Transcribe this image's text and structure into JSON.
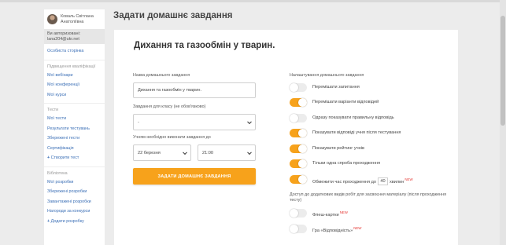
{
  "page_title": "Задати домашнє завдання",
  "sidebar": {
    "user_name": "Коваль Світлана Анатоліївна",
    "auth_line1": "Ви авторизовані:",
    "auth_line2": "lana204@ukr.net",
    "personal_page": "Особиста сторінка",
    "section_qualification": "Підвищення кваліфікації",
    "my_webinars": "Мої вебінари",
    "my_conferences": "Мої конференції",
    "my_courses": "Мої курси",
    "section_tests": "Тести",
    "my_tests": "Мої тести",
    "test_results": "Результати тестувань",
    "saved_tests": "Збережені тести",
    "certification": "Сертифікація",
    "create_test": "Створити тест",
    "section_library": "Бібліотека",
    "my_materials": "Мої розробки",
    "saved_materials": "Збережені розробки",
    "downloaded_materials": "Завантажені розробки",
    "contest_awards": "Нагороди за конкурси",
    "add_material": "Додати розробку"
  },
  "form": {
    "card_title": "Дихання та газообмін у тварин.",
    "name_label": "Назва домашнього завдання",
    "name_value": "Дихання та газообмін  у тварин.",
    "class_label": "Завдання для класу (не обов'язково)",
    "class_value": "-",
    "deadline_label": "Учням необхідно виконати завдання до",
    "date_value": "22 березня",
    "time_value": "21:00",
    "submit_label": "ЗАДАТИ ДОМАШНЄ ЗАВДАННЯ"
  },
  "settings": {
    "title": "Налаштування домашнього завдання",
    "shuffle_questions": "Перемішати запитання",
    "shuffle_answers": "Перемішати варіанти відповідей",
    "show_correct_now": "Одразу показувати правильну відповідь",
    "show_answers_after": "Показувати відповіді учня після тестування",
    "show_rating": "Показувати рейтинг учнів",
    "one_attempt": "Тільки одна спроба проходження",
    "limit_time_prefix": "Обмежити час проходження до",
    "limit_time_value": "40",
    "limit_time_suffix": "хвилин",
    "new_badge": "NEW",
    "extra_note": "Доступ до додаткових видів робіт для засвоєння матеріалу (після проходження тесту)",
    "flashcards": "Флеш-картки",
    "game": "Гра «Відповідність»"
  },
  "toggle_states": {
    "shuffle_questions": false,
    "shuffle_answers": true,
    "show_correct_now": false,
    "show_answers_after": true,
    "show_rating": true,
    "one_attempt": true,
    "limit_time": true,
    "flashcards": false,
    "game": false
  },
  "colors": {
    "accent": "#f7a21b",
    "link": "#3b6fb6",
    "new_badge": "#e53935"
  }
}
